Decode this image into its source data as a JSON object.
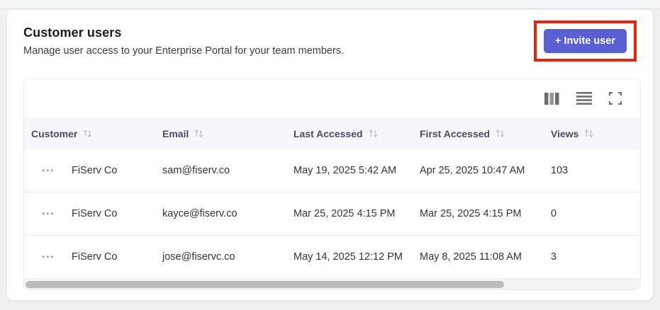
{
  "page": {
    "title": "Customer users",
    "subtitle": "Manage user access to your Enterprise Portal for your team members.",
    "invite_button": "+ Invite user",
    "colors": {
      "accent": "#5a5fd3",
      "highlight_box": "#e8230d",
      "header_bg": "#f7f7fb"
    }
  },
  "toolbar": {
    "icons": [
      "columns-icon",
      "row-density-icon",
      "fullscreen-icon"
    ]
  },
  "icons": {
    "row_actions": "•••"
  },
  "table": {
    "columns": [
      {
        "label": "Customer",
        "sortable": true
      },
      {
        "label": "Email",
        "sortable": true
      },
      {
        "label": "Last Accessed",
        "sortable": true
      },
      {
        "label": "First Accessed",
        "sortable": true
      },
      {
        "label": "Views",
        "sortable": true
      }
    ],
    "rows": [
      {
        "customer": "FiServ Co",
        "email": "sam@fiserv.co",
        "last_accessed": "May 19, 2025 5:42 AM",
        "first_accessed": "Apr 25, 2025 10:47 AM",
        "views": "103"
      },
      {
        "customer": "FiServ Co",
        "email": "kayce@fiserv.co",
        "last_accessed": "Mar 25, 2025 4:15 PM",
        "first_accessed": "Mar 25, 2025 4:15 PM",
        "views": "0"
      },
      {
        "customer": "FiServ Co",
        "email": "jose@fiservc.co",
        "last_accessed": "May 14, 2025 12:12 PM",
        "first_accessed": "May 8, 2025 11:08 AM",
        "views": "3"
      }
    ]
  }
}
